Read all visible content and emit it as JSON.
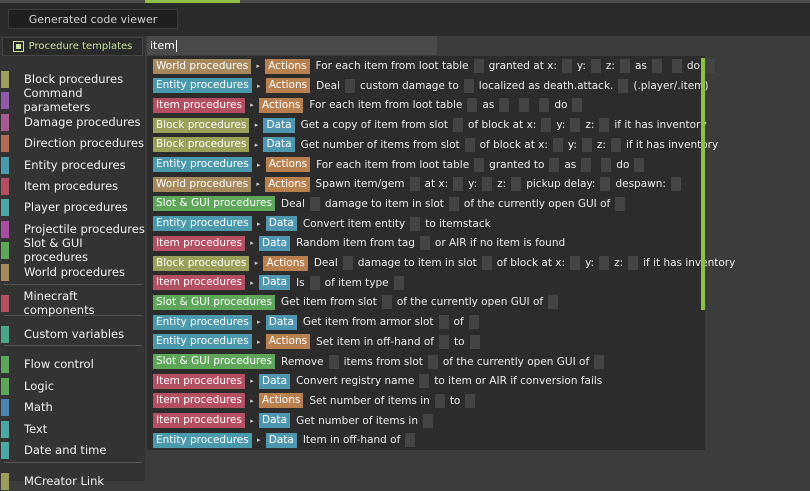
{
  "topbar": {
    "code_viewer_label": "Generated code viewer"
  },
  "sidebar": {
    "header_label": "Procedure templates",
    "categories": [
      {
        "label": "Block procedures",
        "color": "#9aa05a"
      },
      {
        "label": "Command parameters",
        "color": "#8e5ba8"
      },
      {
        "label": "Damage procedures",
        "color": "#a85b8e"
      },
      {
        "label": "Direction procedures",
        "color": "#b06a55"
      },
      {
        "label": "Entity procedures",
        "color": "#4a99ad"
      },
      {
        "label": "Item procedures",
        "color": "#b34f61"
      },
      {
        "label": "Player procedures",
        "color": "#4aa8a0"
      },
      {
        "label": "Projectile procedures",
        "color": "#a84ea0"
      },
      {
        "label": "Slot & GUI procedures",
        "color": "#5ea65a"
      },
      {
        "label": "World procedures",
        "color": "#a68a5e"
      },
      {
        "label": "Minecraft components",
        "color": "#b34f61"
      },
      {
        "label": "Custom variables",
        "color": "#4aa58a"
      },
      {
        "label": "Flow control",
        "color": "#5ea65a"
      },
      {
        "label": "Logic",
        "color": "#5ea65a"
      },
      {
        "label": "Math",
        "color": "#4a82b0"
      },
      {
        "label": "Text",
        "color": "#4aa8a0"
      },
      {
        "label": "Date and time",
        "color": "#4aa8a0"
      },
      {
        "label": "MCreator Link",
        "color": "#9aa05a"
      }
    ]
  },
  "search": {
    "value": "item"
  },
  "results": [
    {
      "cat": "World procedures",
      "kind": "Actions",
      "parts": [
        "For each item from loot table",
        "granted at x:",
        "y:",
        "z:",
        "as",
        "",
        "do",
        ""
      ]
    },
    {
      "cat": "Entity procedures",
      "kind": "Actions",
      "parts": [
        "Deal",
        "custom damage to",
        "localized as death.attack.",
        "(.player/.item)"
      ]
    },
    {
      "cat": "Item procedures",
      "kind": "Actions",
      "parts": [
        "For each item from loot table",
        "as",
        "",
        "",
        "do",
        ""
      ]
    },
    {
      "cat": "Block procedures",
      "kind": "Data",
      "parts": [
        "Get a copy of item from slot",
        "of block at x:",
        "y:",
        "z:",
        "if it has inventory"
      ]
    },
    {
      "cat": "Block procedures",
      "kind": "Data",
      "parts": [
        "Get number of items from slot",
        "of block at x:",
        "y:",
        "z:",
        "if it has inventory"
      ]
    },
    {
      "cat": "Entity procedures",
      "kind": "Actions",
      "parts": [
        "For each item from loot table",
        "granted to",
        "as",
        "",
        "do",
        ""
      ]
    },
    {
      "cat": "World procedures",
      "kind": "Actions",
      "parts": [
        "Spawn item/gem",
        "at x:",
        "y:",
        "z:",
        "pickup delay:",
        "despawn:",
        ""
      ]
    },
    {
      "cat": "Slot & GUI procedures",
      "kind": "",
      "parts": [
        "Deal",
        "damage to item in slot",
        "of the currently open GUI of",
        ""
      ]
    },
    {
      "cat": "Entity procedures",
      "kind": "Data",
      "parts": [
        "Convert item entity",
        "to itemstack"
      ]
    },
    {
      "cat": "Item procedures",
      "kind": "Data",
      "parts": [
        "Random item from tag",
        "or AIR if no item is found"
      ]
    },
    {
      "cat": "Block procedures",
      "kind": "Actions",
      "parts": [
        "Deal",
        "damage to item in slot",
        "of block at x:",
        "y:",
        "z:",
        "if it has inventory"
      ]
    },
    {
      "cat": "Item procedures",
      "kind": "Data",
      "parts": [
        "Is",
        "of item type",
        ""
      ]
    },
    {
      "cat": "Slot & GUI procedures",
      "kind": "",
      "parts": [
        "Get item from slot",
        "of the currently open GUI of",
        ""
      ]
    },
    {
      "cat": "Entity procedures",
      "kind": "Data",
      "parts": [
        "Get item from armor slot",
        "of",
        ""
      ]
    },
    {
      "cat": "Entity procedures",
      "kind": "Actions",
      "parts": [
        "Set item in off-hand of",
        "to",
        ""
      ]
    },
    {
      "cat": "Slot & GUI procedures",
      "kind": "",
      "parts": [
        "Remove",
        "items from slot",
        "of the currently open GUI of",
        ""
      ]
    },
    {
      "cat": "Item procedures",
      "kind": "Data",
      "parts": [
        "Convert registry name",
        "to item or AIR if conversion fails"
      ]
    },
    {
      "cat": "Item procedures",
      "kind": "Actions",
      "parts": [
        "Set number of items in",
        "to",
        ""
      ]
    },
    {
      "cat": "Item procedures",
      "kind": "Data",
      "parts": [
        "Get number of items in",
        ""
      ]
    },
    {
      "cat": "Entity procedures",
      "kind": "Data",
      "parts": [
        "Item in off-hand of",
        ""
      ]
    }
  ]
}
